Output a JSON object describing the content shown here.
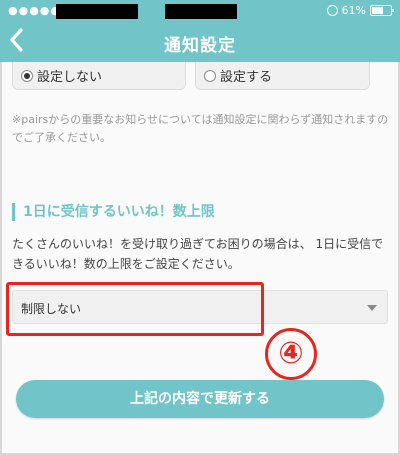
{
  "status_bar": {
    "signal_dots": "●●●●●",
    "battery_text": "61%",
    "icons": [
      "lock-rotation-icon",
      "battery-icon"
    ]
  },
  "header": {
    "title": "通知設定",
    "back_icon": "chevron-left-icon"
  },
  "notification_options": {
    "options": [
      "設定しない",
      "設定する"
    ],
    "selected": "設定しない"
  },
  "notice_text": "※pairsからの重要なお知らせについては通知設定に関わらず通知されますのでご了承ください。",
  "like_limit": {
    "section_title": "1日に受信するいいね！数上限",
    "description": "たくさんのいいね！を受け取り過ぎてお困りの場合は、 1日に受信できるいいね！数の上限をご設定ください。",
    "selected_value": "制限しない"
  },
  "annotation": {
    "step_number": "④",
    "color": "#e8261f"
  },
  "submit_button": {
    "label": "上記の内容で更新する"
  },
  "colors": {
    "accent": "#71c5c9"
  }
}
